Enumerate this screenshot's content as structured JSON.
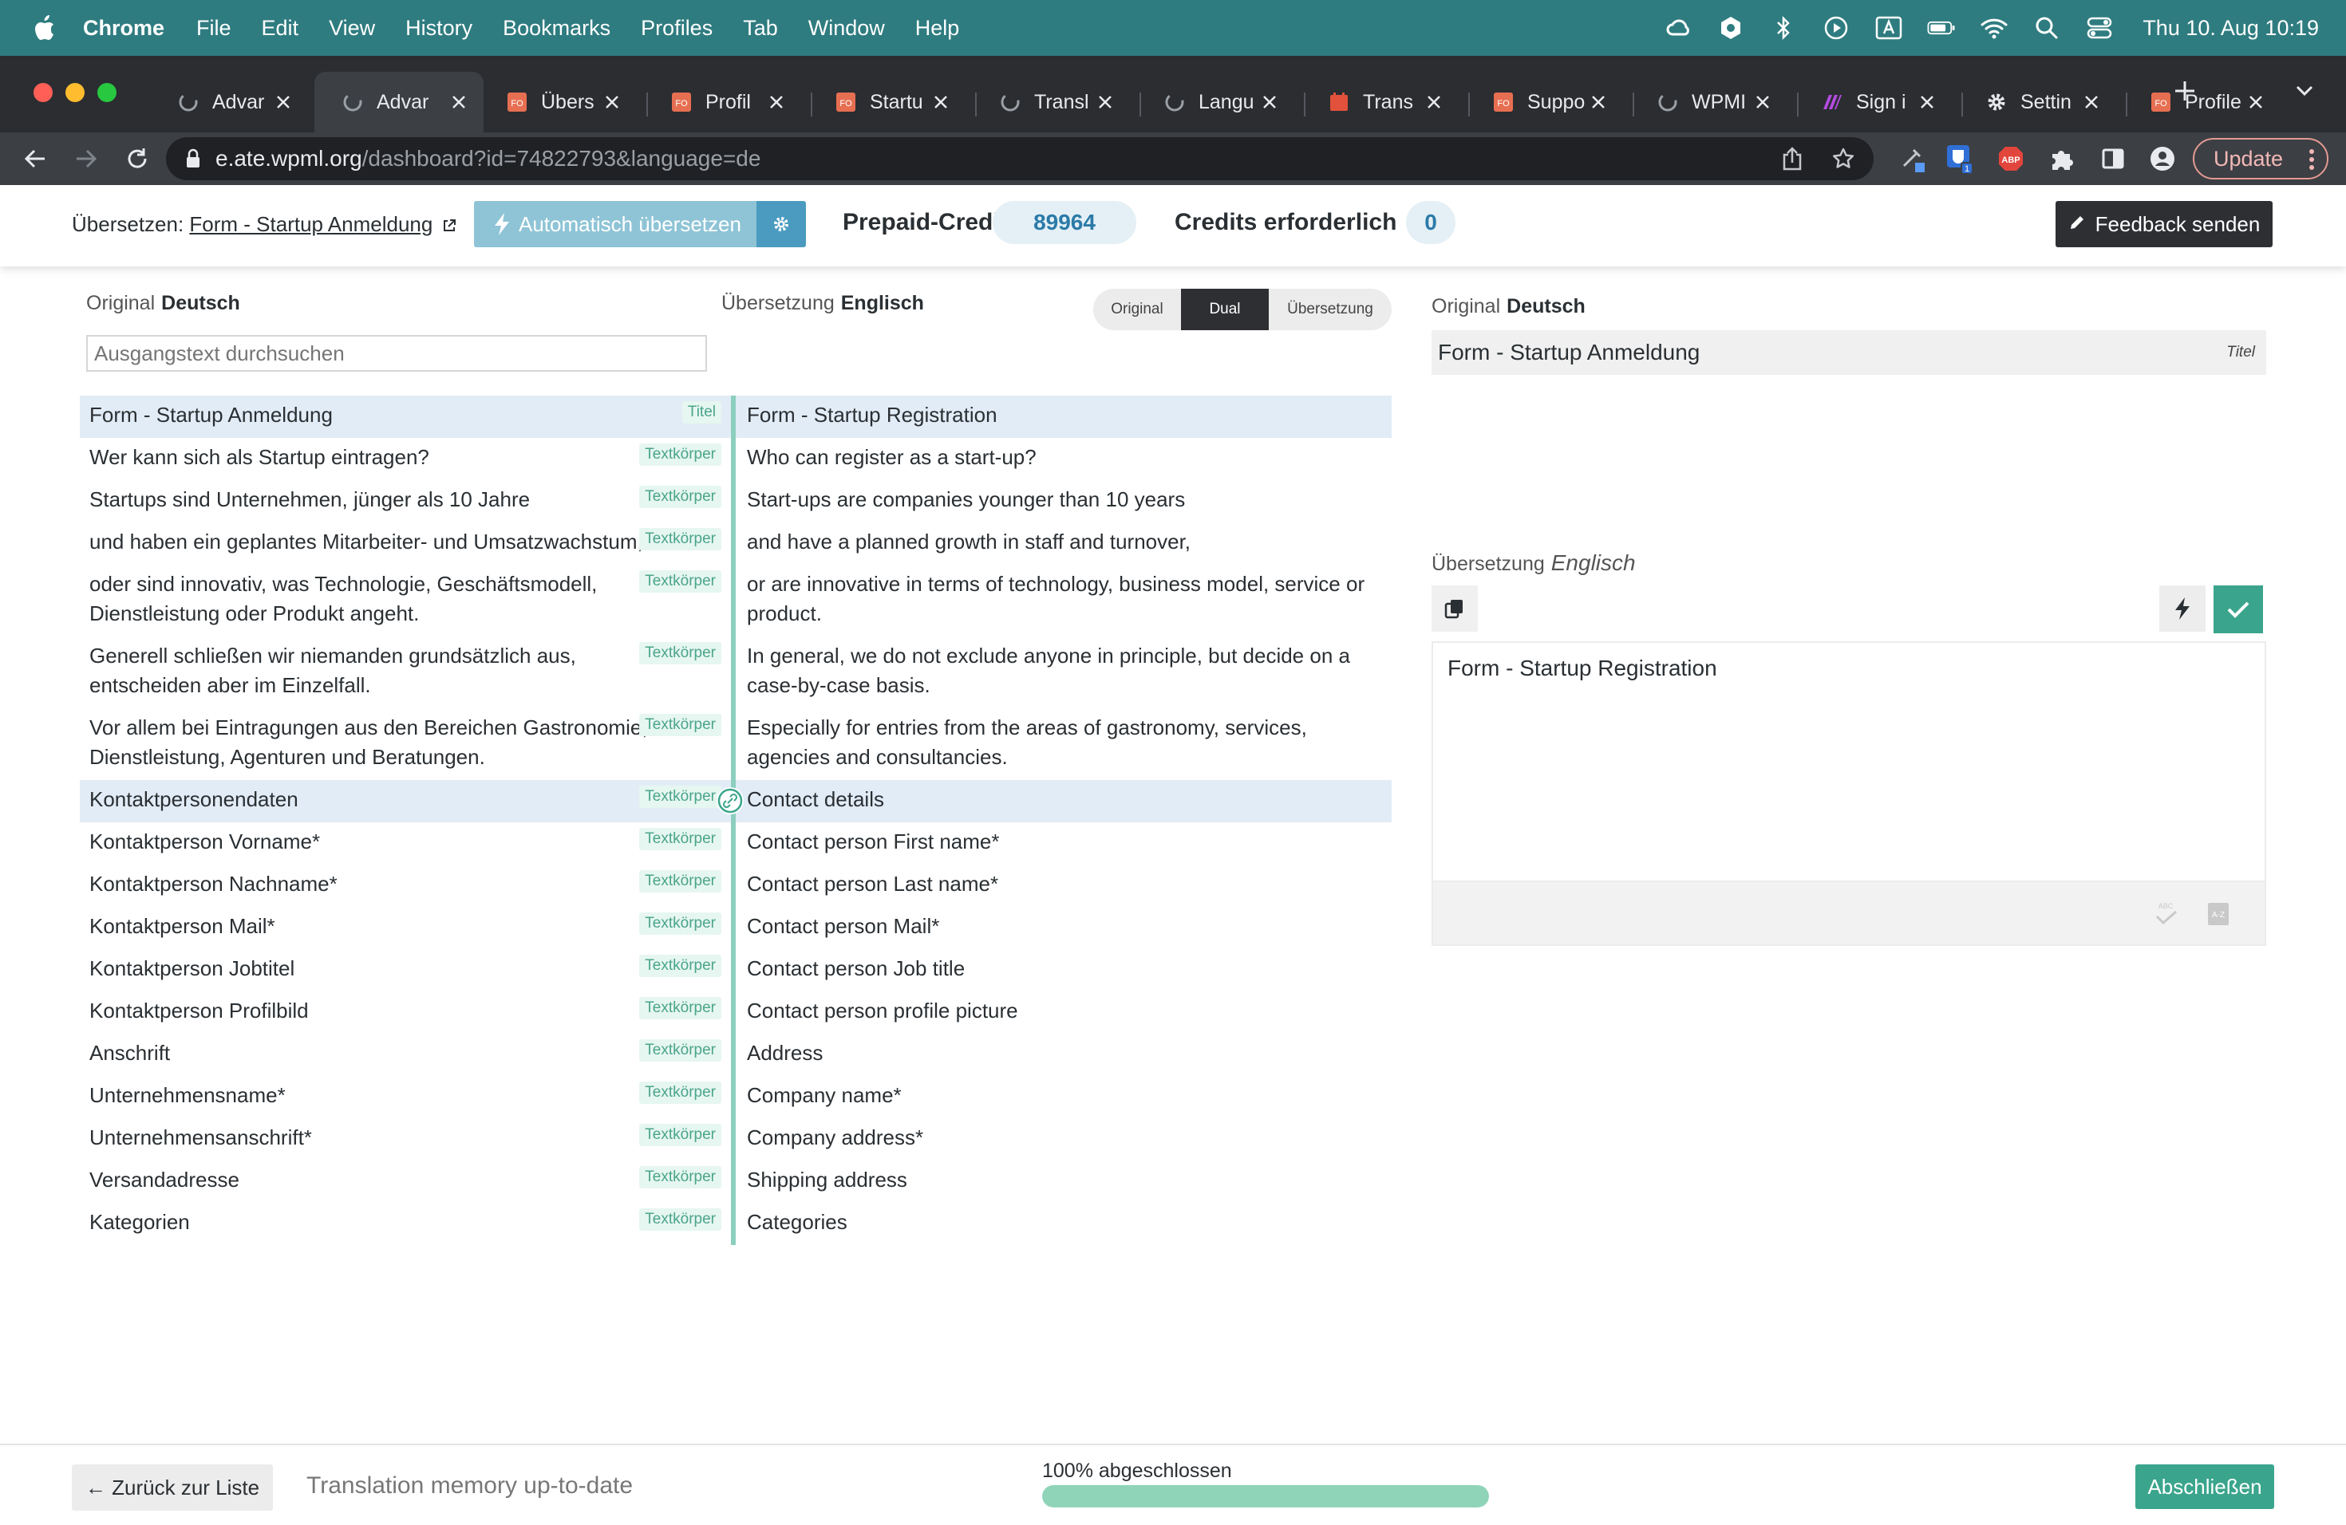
{
  "menubar": {
    "app": "Chrome",
    "items": [
      "File",
      "Edit",
      "View",
      "History",
      "Bookmarks",
      "Profiles",
      "Tab",
      "Window",
      "Help"
    ],
    "clock": "Thu 10. Aug  10:19",
    "status_icons": [
      "creative-cloud-icon",
      "vpn-icon",
      "bluetooth-icon",
      "media-play-icon",
      "input-source-icon",
      "battery-icon",
      "wifi-icon",
      "spotlight-icon",
      "control-center-icon"
    ]
  },
  "browser": {
    "tabs": [
      {
        "label": "Advar",
        "icon": "wpml-icon",
        "active": false
      },
      {
        "label": "Advar",
        "icon": "wpml-icon",
        "active": true
      },
      {
        "label": "Übers",
        "icon": "form-icon",
        "active": false
      },
      {
        "label": "Profil",
        "icon": "form-icon",
        "active": false
      },
      {
        "label": "Startu",
        "icon": "form-icon",
        "active": false
      },
      {
        "label": "Transl",
        "icon": "wpml-icon",
        "active": false
      },
      {
        "label": "Langu",
        "icon": "wpml-icon",
        "active": false
      },
      {
        "label": "Trans",
        "icon": "calendar-icon",
        "active": false
      },
      {
        "label": "Suppo",
        "icon": "form-icon",
        "active": false
      },
      {
        "label": "WPMI",
        "icon": "wpml-icon",
        "active": false
      },
      {
        "label": "Sign i",
        "icon": "sign-in-icon",
        "active": false
      },
      {
        "label": "Settin",
        "icon": "gear-icon",
        "active": false
      },
      {
        "label": "Profile",
        "icon": "form-icon",
        "active": false
      }
    ],
    "url_host": "e.ate.wpml.org",
    "url_path": "/dashboard?id=74822793&language=de",
    "update_label": "Update"
  },
  "header": {
    "translate_prefix": "Übersetzen:",
    "document_link": "Form - Startup Anmeldung",
    "auto_translate_label": "Automatisch übersetzen",
    "prepaid_label": "Prepaid-Credits:",
    "prepaid_value": "89964",
    "required_label": "Credits erforderlich",
    "required_value": "0",
    "feedback_label": "Feedback senden"
  },
  "editor": {
    "original_label": "Original",
    "original_lang": "Deutsch",
    "translation_label": "Übersetzung",
    "translation_lang": "Englisch",
    "view_modes": [
      "Original",
      "Dual",
      "Übersetzung"
    ],
    "active_view": "Dual",
    "search_placeholder": "Ausgangstext durchsuchen",
    "rows": [
      {
        "source": "Form - Startup Anmeldung",
        "tag": "Titel",
        "target": "Form - Startup Registration",
        "highlight": true
      },
      {
        "source": "Wer kann sich als Startup eintragen?",
        "tag": "Textkörper",
        "target": "Who can register as a start-up?",
        "highlight": false
      },
      {
        "source": "Startups sind Unternehmen, jünger als 10 Jahre",
        "tag": "Textkörper",
        "target": "Start-ups are companies younger than 10 years",
        "highlight": false
      },
      {
        "source": "und haben ein geplantes Mitarbeiter- und Umsatzwachstum,",
        "tag": "Textkörper",
        "target": "and have a planned growth in staff and turnover,",
        "highlight": false
      },
      {
        "source": "oder sind innovativ, was Technologie, Geschäftsmodell, Dienstleistung oder Produkt angeht.",
        "tag": "Textkörper",
        "target": "or are innovative in terms of technology, business model, service or product.",
        "highlight": false
      },
      {
        "source": "Generell schließen wir niemanden grundsätzlich aus, entscheiden aber im Einzelfall.",
        "tag": "Textkörper",
        "target": "In general, we do not exclude anyone in principle, but decide on a case-by-case basis.",
        "highlight": false
      },
      {
        "source": "Vor allem bei Eintragungen aus den Bereichen Gastronomie, Dienstleistung, Agenturen und Beratungen.",
        "tag": "Textkörper",
        "target": "Especially for entries from the areas of gastronomy, services, agencies and consultancies.",
        "highlight": false
      },
      {
        "source": "Kontaktpersonendaten",
        "tag": "Textkörper",
        "target": "Contact details",
        "highlight": true
      },
      {
        "source": "Kontaktperson Vorname*",
        "tag": "Textkörper",
        "target": "Contact person First name*",
        "highlight": false
      },
      {
        "source": "Kontaktperson Nachname*",
        "tag": "Textkörper",
        "target": "Contact person Last name*",
        "highlight": false
      },
      {
        "source": "Kontaktperson Mail*",
        "tag": "Textkörper",
        "target": "Contact person Mail*",
        "highlight": false
      },
      {
        "source": "Kontaktperson Jobtitel",
        "tag": "Textkörper",
        "target": "Contact person Job title",
        "highlight": false
      },
      {
        "source": "Kontaktperson Profilbild",
        "tag": "Textkörper",
        "target": "Contact person profile picture",
        "highlight": false
      },
      {
        "source": "Anschrift",
        "tag": "Textkörper",
        "target": "Address",
        "highlight": false
      },
      {
        "source": "Unternehmensname*",
        "tag": "Textkörper",
        "target": "Company name*",
        "highlight": false
      },
      {
        "source": "Unternehmensanschrift*",
        "tag": "Textkörper",
        "target": "Company address*",
        "highlight": false
      },
      {
        "source": "Versandadresse",
        "tag": "Textkörper",
        "target": "Shipping address",
        "highlight": false
      },
      {
        "source": "Kategorien",
        "tag": "Textkörper",
        "target": "Categories",
        "highlight": false
      }
    ]
  },
  "panel": {
    "original_label": "Original",
    "original_lang": "Deutsch",
    "original_text": "Form - Startup Anmeldung",
    "original_tag": "Titel",
    "translation_label": "Übersetzung",
    "translation_lang": "Englisch",
    "translation_text": "Form - Startup Registration"
  },
  "footer": {
    "back_label": "← Zurück zur Liste",
    "tm_status": "Translation memory up-to-date",
    "progress_label": "100% abgeschlossen",
    "progress_fraction": 1.0,
    "finish_label": "Abschließen"
  },
  "colors": {
    "menubar": "#2f7c80",
    "accent_green": "#3aa58c",
    "accent_blue": "#4a9bbf",
    "row_highlight": "#e2ecf6"
  }
}
